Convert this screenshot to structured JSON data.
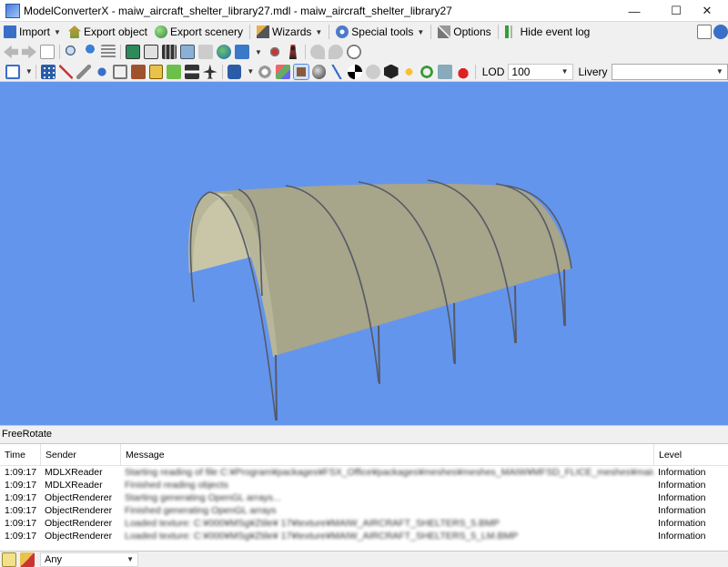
{
  "window": {
    "title": "ModelConverterX - maiw_aircraft_shelter_library27.mdl - maiw_aircraft_shelter_library27",
    "minimize_glyph": "—",
    "maximize_glyph": "☐",
    "close_glyph": "✕"
  },
  "menu": {
    "import": "Import",
    "export_object": "Export object",
    "export_scenery": "Export scenery",
    "wizards": "Wizards",
    "special_tools": "Special tools",
    "options": "Options",
    "hide_event_log": "Hide event log"
  },
  "toolbar3": {
    "lod_label": "LOD",
    "lod_value": "100",
    "livery_label": "Livery",
    "livery_value": ""
  },
  "mode_label": "FreeRotate",
  "log": {
    "columns": {
      "time": "Time",
      "sender": "Sender",
      "message": "Message",
      "level": "Level"
    },
    "rows": [
      {
        "time": "1:09:17",
        "sender": "MDLXReader",
        "message": "Starting reading of file C:¥Program¥packages¥FSX_Office¥packages¥meshes¥meshes_MAIW¥MFSD_FLICE_meshes¥maiw_aircraft_sh...",
        "level": "Information"
      },
      {
        "time": "1:09:17",
        "sender": "MDLXReader",
        "message": "Finished reading objects",
        "level": "Information"
      },
      {
        "time": "1:09:17",
        "sender": "ObjectRenderer",
        "message": "Starting generating OpenGL arrays...",
        "level": "Information"
      },
      {
        "time": "1:09:17",
        "sender": "ObjectRenderer",
        "message": "Finished generating OpenGL arrays",
        "level": "Information"
      },
      {
        "time": "1:09:17",
        "sender": "ObjectRenderer",
        "message": "Loaded texture: C:¥000¥MSg¥Ztile¥ 17¥texture¥MAIW_AIRCRAFT_SHELTERS_5.BMP",
        "level": "Information"
      },
      {
        "time": "1:09:17",
        "sender": "ObjectRenderer",
        "message": "Loaded texture: C:¥000¥MSg¥Ztile¥ 17¥texture¥MAIW_AIRCRAFT_SHELTERS_5_LM.BMP",
        "level": "Information"
      }
    ]
  },
  "filter": {
    "level": "Any"
  },
  "colors": {
    "viewport_bg": "#6495ed",
    "shelter_roof": "#a7a58a",
    "shelter_underside": "#c9c6a8",
    "frame": "#555a66"
  }
}
